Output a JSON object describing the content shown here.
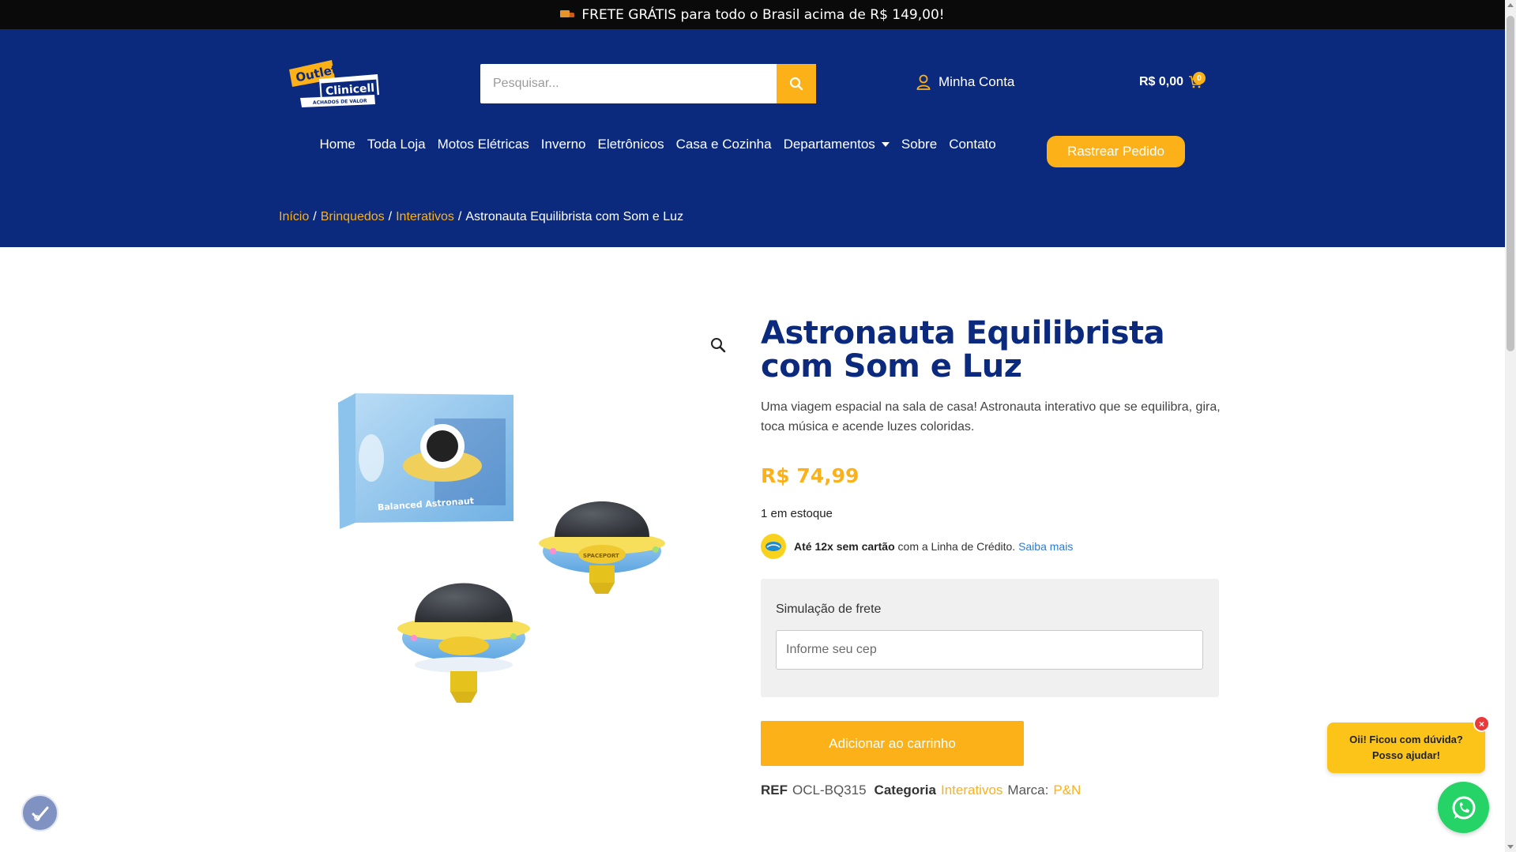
{
  "topbar": {
    "icon": "truck-icon",
    "text": "FRETE GRÁTIS para todo o Brasil acima de R$ 149,00!"
  },
  "header": {
    "logo": {
      "line1": "Outlet",
      "line2": "Clinicell",
      "tagline": "ACHADOS DE VALOR"
    },
    "search": {
      "placeholder": "Pesquisar..."
    },
    "account_label": "Minha Conta",
    "cart_total": "R$ 0,00",
    "cart_count": "0",
    "nav": [
      {
        "label": "Home"
      },
      {
        "label": "Toda Loja"
      },
      {
        "label": "Motos Elétricas"
      },
      {
        "label": "Inverno"
      },
      {
        "label": "Eletrônicos"
      },
      {
        "label": "Casa e Cozinha"
      },
      {
        "label": "Departamentos",
        "has_dropdown": true
      },
      {
        "label": "Sobre"
      },
      {
        "label": "Contato"
      }
    ],
    "track_button": "Rastrear Pedido",
    "breadcrumb": {
      "items": [
        "Início",
        "Brinquedos",
        "Interativos"
      ],
      "current": "Astronauta Equilibrista com Som e Luz",
      "separator": "/"
    }
  },
  "product": {
    "title": "Astronauta Equilibrista com Som e Luz",
    "description": "Uma viagem espacial na sala de casa! Astronauta interativo que se equilibra, gira, toca música e acende luzes coloridas.",
    "price": "R$ 74,99",
    "stock": "1 em estoque",
    "credit": {
      "bold": "Até 12x sem cartão",
      "text": "com a Linha de Crédito.",
      "link": "Saiba mais"
    },
    "shipping": {
      "label": "Simulação de frete",
      "placeholder": "Informe seu cep"
    },
    "add_to_cart": "Adicionar ao carrinho",
    "meta": {
      "ref_label": "REF",
      "ref_value": "OCL-BQ315",
      "category_label": "Categoria",
      "category_value": "Interativos",
      "brand_label": "Marca:",
      "brand_value": "P&N"
    },
    "image_text": {
      "box_label": "Balanced Astronaut",
      "ufo_label": "SPACEPORT"
    }
  },
  "chat": {
    "line1": "Oii! Ficou com dúvida?",
    "line2": "Posso ajudar!",
    "close": "×"
  },
  "colors": {
    "navy": "#0b2a7e",
    "accent": "#fbb117",
    "topbar": "#0a0a0a",
    "whatsapp": "#25d366"
  }
}
